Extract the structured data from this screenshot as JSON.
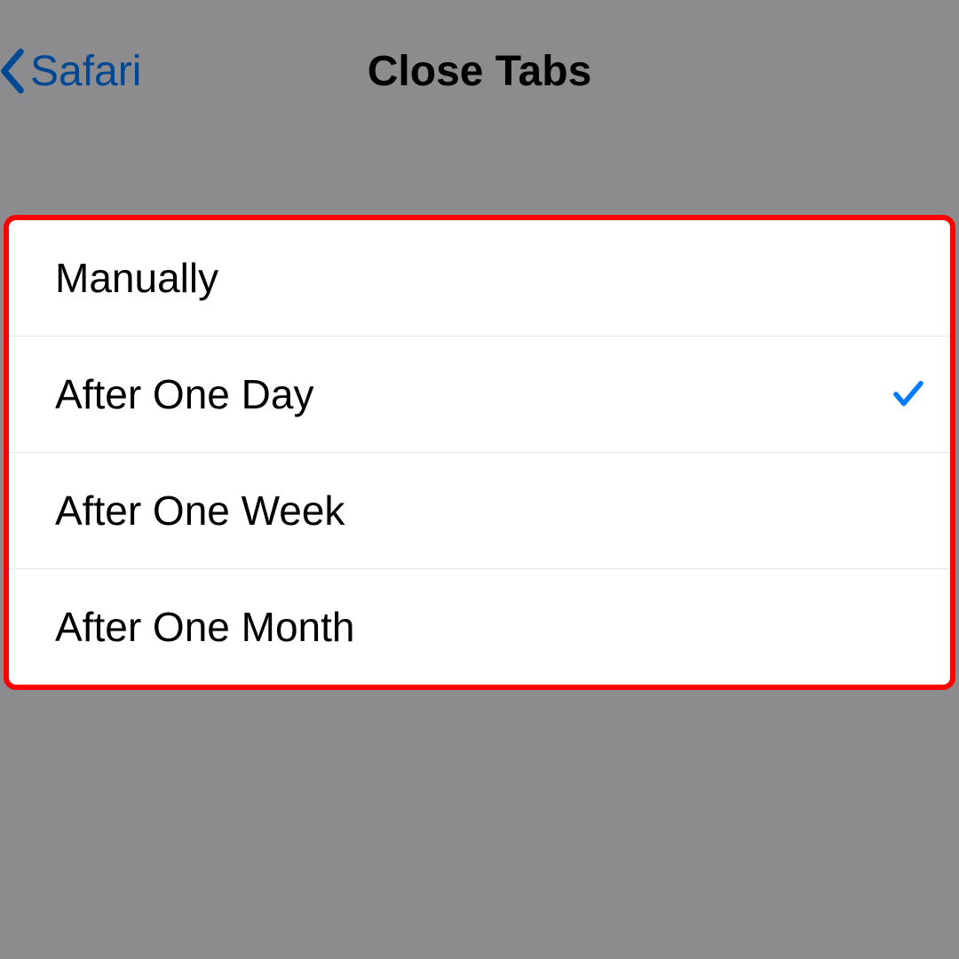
{
  "header": {
    "back_label": "Safari",
    "title": "Close Tabs"
  },
  "options": [
    {
      "label": "Manually",
      "selected": false
    },
    {
      "label": "After One Day",
      "selected": true
    },
    {
      "label": "After One Week",
      "selected": false
    },
    {
      "label": "After One Month",
      "selected": false
    }
  ],
  "colors": {
    "accent": "#007AFF",
    "highlight": "#ff0000"
  }
}
